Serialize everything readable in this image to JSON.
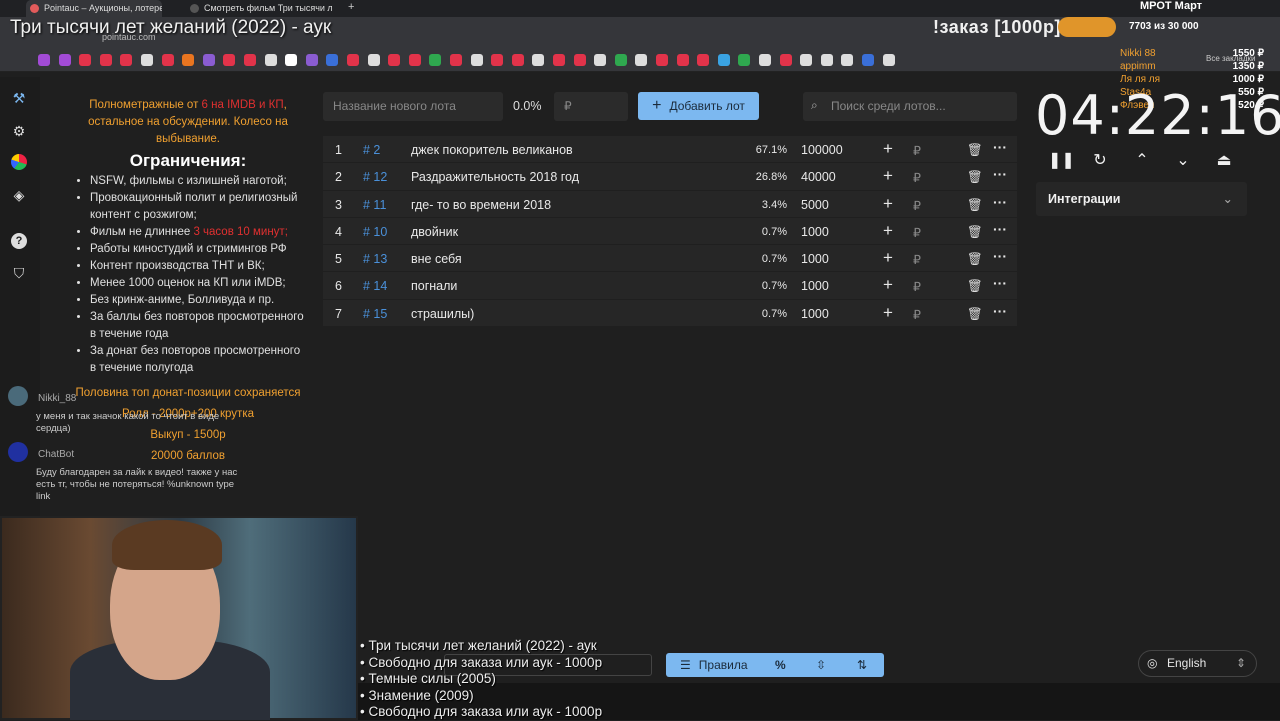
{
  "browser": {
    "tabs": [
      {
        "label": "Pointauc – Аукционы, лотерея",
        "active": true
      },
      {
        "label": "Смотреть фильм Три тысячи л",
        "active": false
      }
    ],
    "url": "pointauc.com"
  },
  "stream": {
    "title": "Три тысячи лет желаний (2022) - аук",
    "order_banner": "!заказ [1000р]",
    "mrot_label": "МРОТ Март",
    "progress": "7703  из 30 000",
    "bookmarks_other": "Все закладки",
    "donors": [
      {
        "name": "Nikki 88",
        "amount": "1550 ₽"
      },
      {
        "name": "appimm",
        "amount": "1350 ₽"
      },
      {
        "name": "Ля ля ля",
        "amount": "1000 ₽"
      },
      {
        "name": "Stas4a",
        "amount": "550 ₽"
      },
      {
        "name": "Флэвел",
        "amount": "520 ₽"
      }
    ]
  },
  "rules": {
    "intro_a": "Полнометражные от ",
    "intro_b": "6 на IMDB и КП",
    "intro_c": ", остальное на обсуждении. Колесо на выбывание.",
    "heading": "Ограничения:",
    "items": [
      "NSFW, фильмы с излишней наготой;",
      "Провокационный полит и религиозный контент с розжигом;",
      "Фильм не длиннее ",
      "Работы киностудий и стримингов РФ",
      "Контент производства ТНТ и ВК;",
      "Менее 1000 оценок на КП или iMDB;",
      "Без кринж-аниме, Болливуда и пр.",
      "За баллы без повторов просмотренного в течение года",
      "За донат без повторов просмотренного в течение полугода"
    ],
    "length_limit": "3 часов 10 минут;",
    "half_top": "Половина топ донат-позиции сохраняется",
    "reroll": "Ролл - 2000р+200 крутка",
    "buyout": "Выкуп - 1500р",
    "points": "20000 баллов"
  },
  "chat": [
    {
      "name": "Nikki_88",
      "msg": "у меня и так значок какой то чтоит в виде сердца)"
    },
    {
      "name": "ChatBot",
      "msg": "Буду благодарен за лайк к видео! также у нас есть тг, чтобы не потеряться! %unknown type link"
    }
  ],
  "toolbar": {
    "new_lot_placeholder": "Название нового лота",
    "percent": "0.0%",
    "amount_placeholder": "₽",
    "add_label": "Добавить лот",
    "search_placeholder": "Поиск среди лотов..."
  },
  "lots": [
    {
      "idx": "1",
      "id": "# 2",
      "name": "джек покоритель великанов",
      "pct": "67.1%",
      "amount": "100000"
    },
    {
      "idx": "2",
      "id": "# 12",
      "name": "Раздражительность 2018 год",
      "pct": "26.8%",
      "amount": "40000"
    },
    {
      "idx": "3",
      "id": "# 11",
      "name": "где- то во времени 2018",
      "pct": "3.4%",
      "amount": "5000"
    },
    {
      "idx": "4",
      "id": "# 10",
      "name": "двойник",
      "pct": "0.7%",
      "amount": "1000"
    },
    {
      "idx": "5",
      "id": "# 13",
      "name": "вне себя",
      "pct": "0.7%",
      "amount": "1000"
    },
    {
      "idx": "6",
      "id": "# 14",
      "name": "погнали",
      "pct": "0.7%",
      "amount": "1000"
    },
    {
      "idx": "7",
      "id": "# 15",
      "name": "страшилы)",
      "pct": "0.7%",
      "amount": "1000"
    }
  ],
  "timer": {
    "value": "04:22:16"
  },
  "integrations": {
    "label": "Интеграции"
  },
  "bottom": {
    "list": [
      "• Три тысячи лет желаний (2022) - аук",
      "• Свободно для заказа или аук - 1000р",
      "• Темные силы (2005)",
      "• Знамение (2009)",
      "• Свободно для заказа или аук - 1000р"
    ],
    "rules_label": "Правила",
    "language": "English"
  }
}
